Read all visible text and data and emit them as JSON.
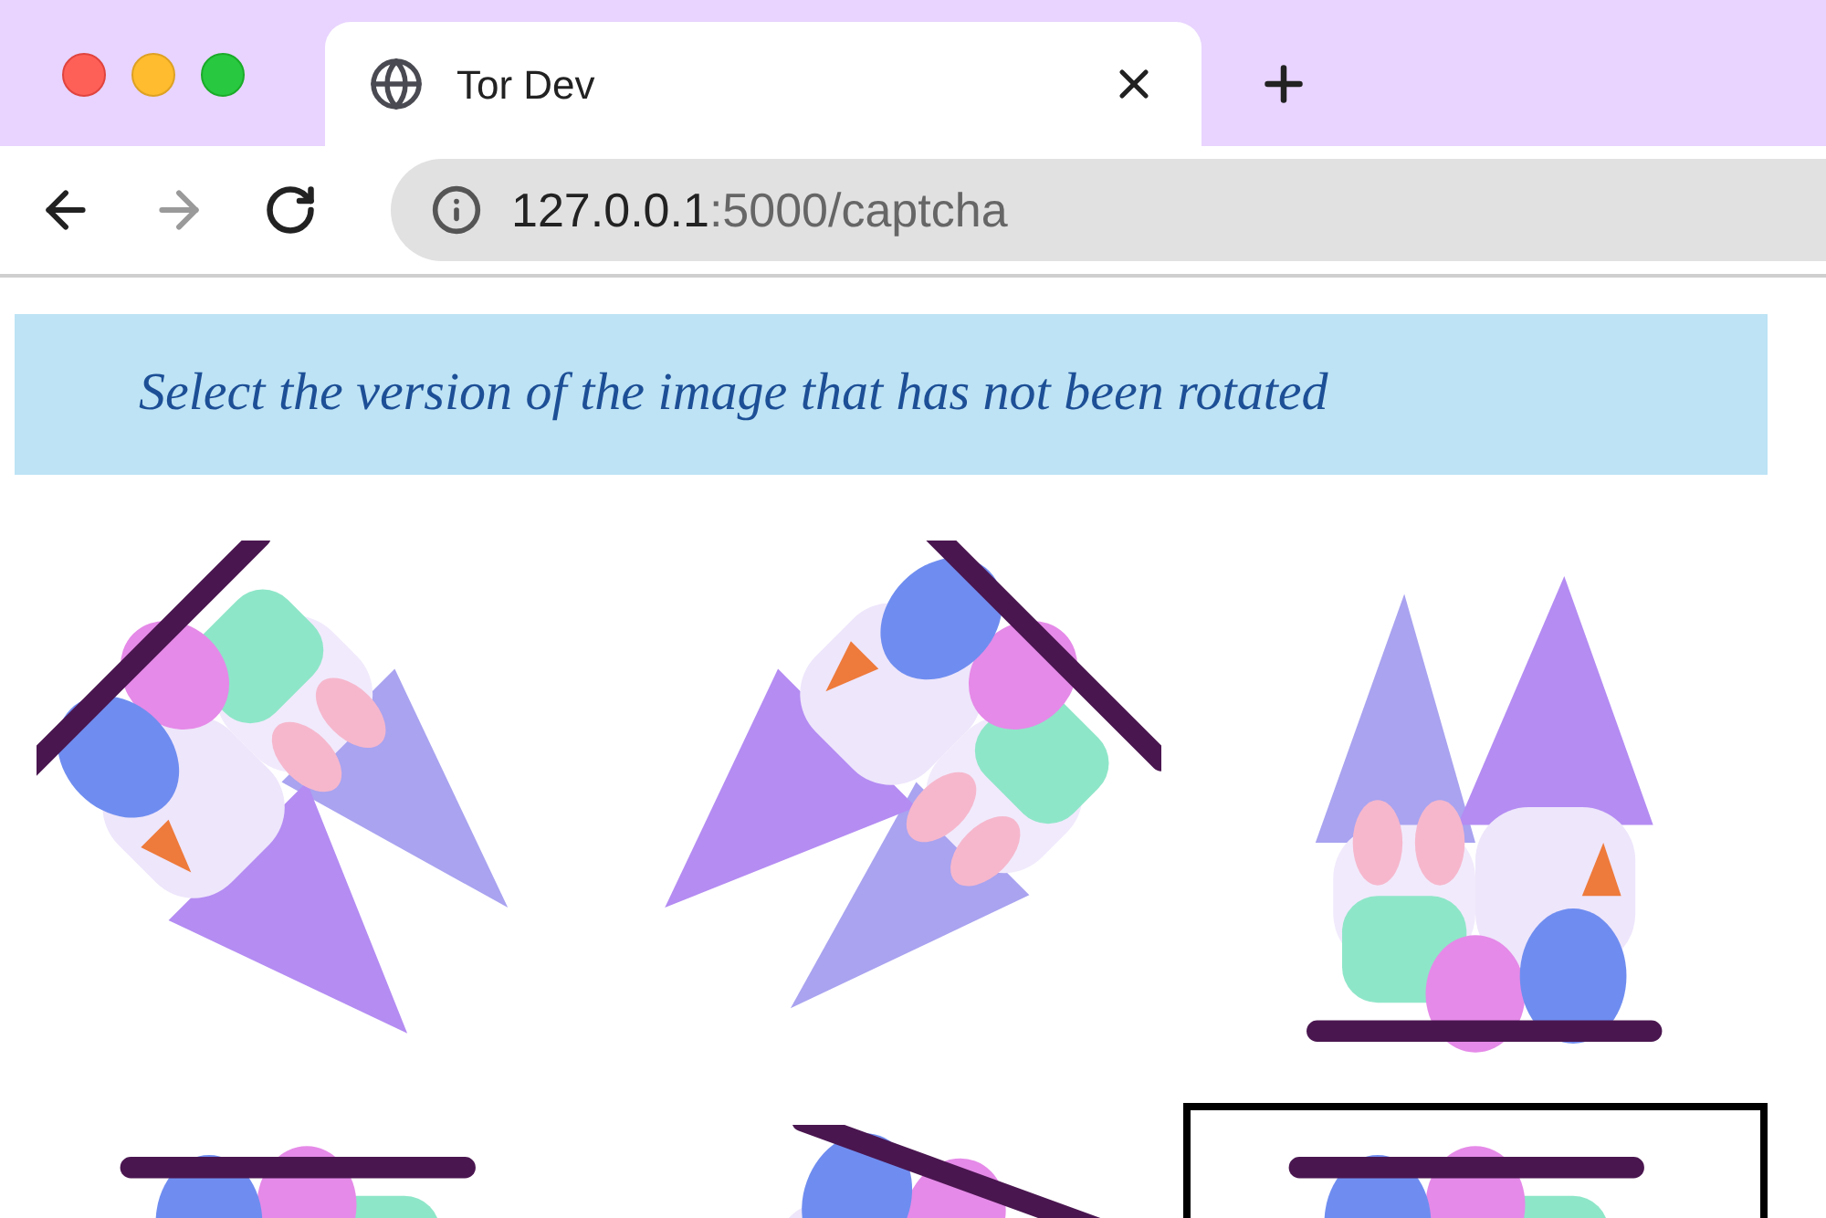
{
  "tab": {
    "title": "Tor Dev"
  },
  "address_bar": {
    "host": "127.0.0.1",
    "path": ":5000/captcha"
  },
  "banner": {
    "text": "Select the version of the image that has not been rotated"
  },
  "images": [
    {
      "kind": "picture",
      "selected": false
    },
    {
      "kind": "picture",
      "selected": false
    },
    {
      "kind": "picture",
      "selected": false
    },
    {
      "kind": "picture",
      "selected": false
    },
    {
      "kind": "picture",
      "selected": false
    },
    {
      "kind": "picture",
      "selected": true
    }
  ]
}
